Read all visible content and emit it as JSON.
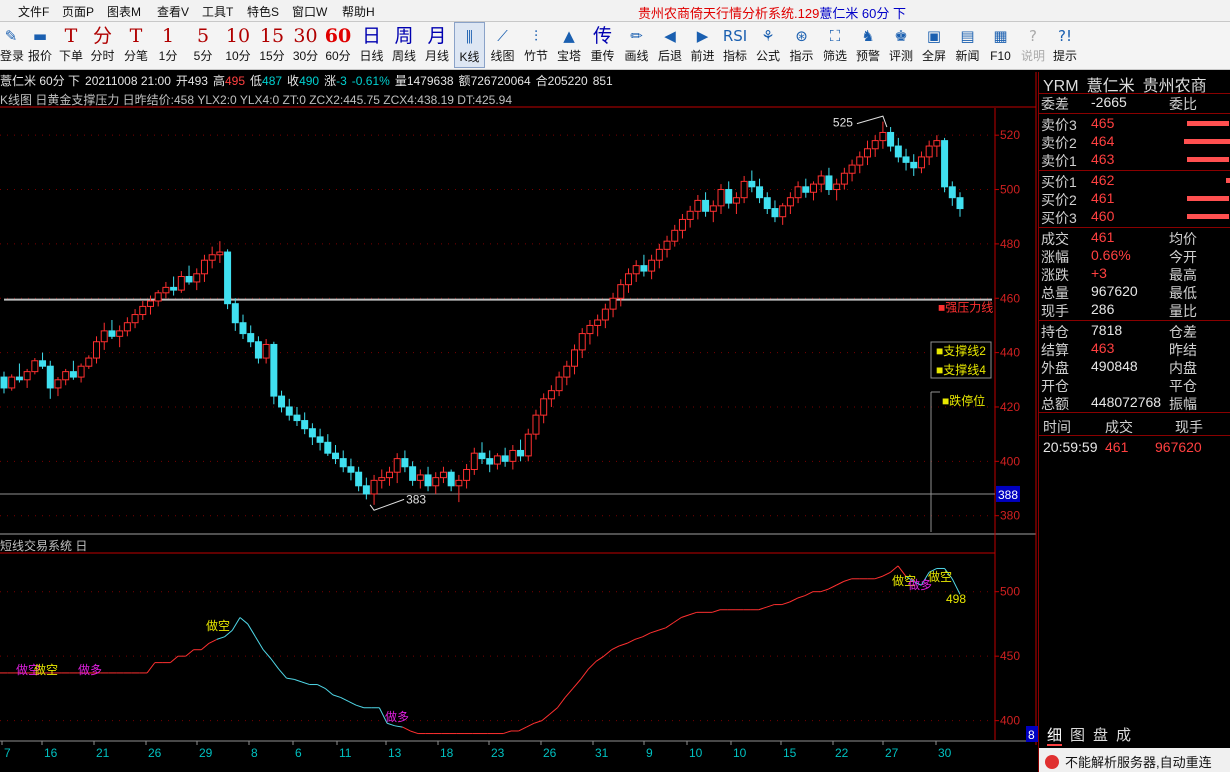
{
  "menubar": {
    "items": [
      "文件F",
      "页面P",
      "图表M",
      "查看V",
      "工具T",
      "特色S",
      "窗口W",
      "帮助H"
    ],
    "title_prefix": "贵州农商倚天行情分析系统.129",
    "title_stock": "薏仁米 60分 下"
  },
  "toolbar": [
    {
      "glyph": "✎",
      "label": "登录",
      "style": "icon"
    },
    {
      "glyph": "▬",
      "label": "报价",
      "style": "icon"
    },
    {
      "glyph": "T",
      "label": "下单",
      "style": ""
    },
    {
      "glyph": "分",
      "label": "分时",
      "style": ""
    },
    {
      "glyph": "T",
      "label": "分笔",
      "style": ""
    },
    {
      "glyph": "1",
      "label": "1分",
      "style": ""
    },
    {
      "glyph": "5",
      "label": "5分",
      "style": ""
    },
    {
      "glyph": "10",
      "label": "10分",
      "style": ""
    },
    {
      "glyph": "15",
      "label": "15分",
      "style": ""
    },
    {
      "glyph": "30",
      "label": "30分",
      "style": ""
    },
    {
      "glyph": "60",
      "label": "60分",
      "style": "red"
    },
    {
      "glyph": "日",
      "label": "日线",
      "style": "blue"
    },
    {
      "glyph": "周",
      "label": "周线",
      "style": "blue"
    },
    {
      "glyph": "月",
      "label": "月线",
      "style": "blue"
    },
    {
      "glyph": "⫼",
      "label": "K线",
      "style": "icon",
      "active": true
    },
    {
      "glyph": "⟋",
      "label": "线图",
      "style": "icon"
    },
    {
      "glyph": "⫶",
      "label": "竹节",
      "style": "icon"
    },
    {
      "glyph": "▲",
      "label": "宝塔",
      "style": "icon"
    },
    {
      "glyph": "传",
      "label": "重传",
      "style": "blue"
    },
    {
      "glyph": "✏",
      "label": "画线",
      "style": "icon"
    },
    {
      "glyph": "◀",
      "label": "后退",
      "style": "icon"
    },
    {
      "glyph": "▶",
      "label": "前进",
      "style": "icon"
    },
    {
      "glyph": "RSI",
      "label": "指标",
      "style": "icon"
    },
    {
      "glyph": "⚘",
      "label": "公式",
      "style": "icon"
    },
    {
      "glyph": "⊛",
      "label": "指示",
      "style": "icon"
    },
    {
      "glyph": "⛶",
      "label": "筛选",
      "style": "icon"
    },
    {
      "glyph": "♞",
      "label": "预警",
      "style": "icon"
    },
    {
      "glyph": "♚",
      "label": "评测",
      "style": "icon"
    },
    {
      "glyph": "▣",
      "label": "全屏",
      "style": "icon"
    },
    {
      "glyph": "▤",
      "label": "新闻",
      "style": "icon"
    },
    {
      "glyph": "▦",
      "label": "F10",
      "style": "icon"
    },
    {
      "glyph": "?",
      "label": "说明",
      "style": "icon",
      "disabled": true
    },
    {
      "glyph": "?!",
      "label": "提示",
      "style": "icon"
    }
  ],
  "quote": {
    "name_period": "薏仁米 60分 下",
    "datetime": "20211008 21:00",
    "open_label": "开",
    "open": "493",
    "high_label": "高",
    "high": "495",
    "low_label": "低",
    "low": "487",
    "close_label": "收",
    "close": "490",
    "change_label": "涨",
    "change": "-3",
    "change_pct": "-0.61%",
    "volume_label": "量",
    "volume": "1479638",
    "amount_label": "额",
    "amount": "726720064",
    "oi_label": "合",
    "oi": "205220",
    "oi_delta": "851"
  },
  "indicator_line": "K线图 日黄金支撑压力 日昨结价:458 YLX2:0 YLX4:0 ZT:0 ZCX2:445.75 ZCX4:438.19 DT:425.94",
  "chart_overlay": {
    "peak_label": "525",
    "trough_label": "383",
    "last_price_badge": "388",
    "resist_label": "■强压力线",
    "support2_label": "■支撑线2",
    "support4_label": "■支撑线4",
    "limit_down_label": "■跌停位",
    "sub_value_label": "498",
    "sub_signal_short": "做空",
    "sub_signal_long": "做多",
    "corner_label": "8"
  },
  "sub_title": "短线交易系统 日",
  "x_axis": {
    "labels": [
      "7",
      "16",
      "21",
      "26",
      "29",
      "8",
      "6",
      "11",
      "13",
      "18",
      "23",
      "26",
      "31",
      "9",
      "10",
      "10",
      "15",
      "22",
      "27",
      "30"
    ]
  },
  "right_panel": {
    "header": [
      "YRM",
      "薏仁米",
      "贵州农商"
    ],
    "weibi": {
      "k1": "委差",
      "v1": "-2665",
      "k2": "委比"
    },
    "asks": [
      {
        "k": "卖价3",
        "v": "465",
        "bar": 0.6
      },
      {
        "k": "卖价2",
        "v": "464",
        "bar": 0.65
      },
      {
        "k": "卖价1",
        "v": "463",
        "bar": 0.6
      }
    ],
    "bids": [
      {
        "k": "买价1",
        "v": "462",
        "bar": 0.05
      },
      {
        "k": "买价2",
        "v": "461",
        "bar": 0.6
      },
      {
        "k": "买价3",
        "v": "460",
        "bar": 0.6
      }
    ],
    "stats": [
      {
        "k": "成交",
        "v": "461",
        "vc": "r",
        "k2": "均价"
      },
      {
        "k": "涨幅",
        "v": "0.66%",
        "vc": "r",
        "k2": "今开"
      },
      {
        "k": "涨跌",
        "v": "+3",
        "vc": "r",
        "k2": "最高"
      },
      {
        "k": "总量",
        "v": "967620",
        "vc": "w",
        "k2": "最低"
      },
      {
        "k": "现手",
        "v": "286",
        "vc": "w",
        "k2": "量比"
      }
    ],
    "stats2": [
      {
        "k": "持仓",
        "v": "7818",
        "vc": "w",
        "k2": "仓差"
      },
      {
        "k": "结算",
        "v": "463",
        "vc": "r",
        "k2": "昨结"
      },
      {
        "k": "外盘",
        "v": "490848",
        "vc": "w",
        "k2": "内盘"
      },
      {
        "k": "开仓",
        "v": "",
        "vc": "w",
        "k2": "平仓"
      },
      {
        "k": "总额",
        "v": "448072768",
        "vc": "w",
        "k2": "振幅"
      }
    ],
    "tick_head": [
      "时间",
      "成交",
      "现手"
    ],
    "tick_row": [
      "20:59:59",
      "461",
      "967620"
    ],
    "tabs": [
      "细",
      "图",
      "盘",
      "成"
    ],
    "status": "不能解析服务器,自动重连"
  },
  "colors": {
    "up": "#ff3030",
    "down": "#40e0f0",
    "axis": "#c00000",
    "resist": "#c0c0c0"
  },
  "chart_data": {
    "type": "candlestick",
    "title": "薏仁米 60分",
    "y_axis_labels": [
      380,
      400,
      420,
      440,
      460,
      480,
      500,
      520
    ],
    "ylim": [
      374,
      530
    ],
    "resist_level": 459.5,
    "last_price_line": 388,
    "candles": [
      [
        431,
        433,
        425,
        427
      ],
      [
        427,
        432,
        426,
        431
      ],
      [
        431,
        436,
        429,
        430
      ],
      [
        430,
        434,
        427,
        433
      ],
      [
        433,
        438,
        432,
        437
      ],
      [
        437,
        440,
        434,
        435
      ],
      [
        435,
        437,
        423,
        427
      ],
      [
        427,
        431,
        424,
        430
      ],
      [
        430,
        434,
        428,
        433
      ],
      [
        433,
        437,
        430,
        431
      ],
      [
        431,
        436,
        429,
        435
      ],
      [
        435,
        439,
        434,
        438
      ],
      [
        438,
        446,
        436,
        444
      ],
      [
        444,
        451,
        441,
        448
      ],
      [
        448,
        452,
        445,
        446
      ],
      [
        446,
        450,
        442,
        448
      ],
      [
        448,
        453,
        446,
        451
      ],
      [
        451,
        456,
        449,
        454
      ],
      [
        454,
        459,
        452,
        457
      ],
      [
        457,
        461,
        454,
        459
      ],
      [
        459,
        463,
        457,
        462
      ],
      [
        462,
        466,
        460,
        464
      ],
      [
        464,
        468,
        461,
        463
      ],
      [
        463,
        470,
        462,
        468
      ],
      [
        468,
        472,
        465,
        466
      ],
      [
        466,
        471,
        463,
        469
      ],
      [
        469,
        476,
        466,
        474
      ],
      [
        474,
        479,
        471,
        476
      ],
      [
        476,
        481,
        473,
        477
      ],
      [
        477,
        478,
        456,
        458
      ],
      [
        458,
        460,
        448,
        451
      ],
      [
        451,
        454,
        445,
        447
      ],
      [
        447,
        450,
        442,
        444
      ],
      [
        444,
        446,
        436,
        438
      ],
      [
        438,
        445,
        436,
        443
      ],
      [
        443,
        444,
        421,
        424
      ],
      [
        424,
        426,
        418,
        420
      ],
      [
        420,
        423,
        415,
        417
      ],
      [
        417,
        420,
        413,
        415
      ],
      [
        415,
        418,
        410,
        412
      ],
      [
        412,
        414,
        406,
        409
      ],
      [
        409,
        412,
        404,
        407
      ],
      [
        407,
        410,
        402,
        403
      ],
      [
        403,
        406,
        399,
        401
      ],
      [
        401,
        404,
        396,
        398
      ],
      [
        398,
        401,
        393,
        396
      ],
      [
        396,
        398,
        389,
        391
      ],
      [
        391,
        394,
        386,
        388
      ],
      [
        388,
        395,
        384,
        393
      ],
      [
        393,
        397,
        390,
        394
      ],
      [
        394,
        398,
        391,
        396
      ],
      [
        396,
        403,
        392,
        401
      ],
      [
        401,
        404,
        396,
        398
      ],
      [
        398,
        400,
        391,
        393
      ],
      [
        393,
        397,
        390,
        395
      ],
      [
        395,
        398,
        389,
        391
      ],
      [
        391,
        396,
        388,
        394
      ],
      [
        394,
        398,
        392,
        396
      ],
      [
        396,
        397,
        389,
        391
      ],
      [
        391,
        395,
        385,
        393
      ],
      [
        393,
        399,
        390,
        397
      ],
      [
        397,
        405,
        395,
        403
      ],
      [
        403,
        407,
        399,
        401
      ],
      [
        401,
        404,
        396,
        399
      ],
      [
        399,
        403,
        397,
        402
      ],
      [
        402,
        405,
        398,
        400
      ],
      [
        400,
        406,
        397,
        404
      ],
      [
        404,
        408,
        400,
        402
      ],
      [
        402,
        412,
        400,
        410
      ],
      [
        410,
        419,
        408,
        417
      ],
      [
        417,
        425,
        414,
        423
      ],
      [
        423,
        428,
        420,
        426
      ],
      [
        426,
        433,
        424,
        431
      ],
      [
        431,
        437,
        428,
        435
      ],
      [
        435,
        443,
        432,
        441
      ],
      [
        441,
        449,
        438,
        447
      ],
      [
        447,
        452,
        443,
        450
      ],
      [
        450,
        454,
        446,
        452
      ],
      [
        452,
        458,
        449,
        456
      ],
      [
        456,
        462,
        453,
        460
      ],
      [
        460,
        467,
        457,
        465
      ],
      [
        465,
        471,
        462,
        469
      ],
      [
        469,
        474,
        466,
        472
      ],
      [
        472,
        476,
        468,
        470
      ],
      [
        470,
        476,
        467,
        474
      ],
      [
        474,
        480,
        471,
        478
      ],
      [
        478,
        483,
        475,
        481
      ],
      [
        481,
        487,
        479,
        485
      ],
      [
        485,
        491,
        482,
        489
      ],
      [
        489,
        494,
        486,
        492
      ],
      [
        492,
        498,
        489,
        496
      ],
      [
        496,
        499,
        490,
        492
      ],
      [
        492,
        496,
        488,
        494
      ],
      [
        494,
        502,
        491,
        500
      ],
      [
        500,
        503,
        493,
        495
      ],
      [
        495,
        499,
        491,
        497
      ],
      [
        497,
        505,
        495,
        503
      ],
      [
        503,
        507,
        499,
        501
      ],
      [
        501,
        504,
        495,
        497
      ],
      [
        497,
        499,
        491,
        493
      ],
      [
        493,
        496,
        488,
        490
      ],
      [
        490,
        495,
        487,
        494
      ],
      [
        494,
        499,
        491,
        497
      ],
      [
        497,
        503,
        495,
        501
      ],
      [
        501,
        504,
        497,
        499
      ],
      [
        499,
        503,
        496,
        502
      ],
      [
        502,
        507,
        499,
        505
      ],
      [
        505,
        508,
        498,
        500
      ],
      [
        500,
        504,
        496,
        502
      ],
      [
        502,
        508,
        500,
        506
      ],
      [
        506,
        511,
        503,
        509
      ],
      [
        509,
        514,
        506,
        512
      ],
      [
        512,
        518,
        509,
        515
      ],
      [
        515,
        520,
        512,
        518
      ],
      [
        518,
        525,
        515,
        521
      ],
      [
        521,
        523,
        514,
        516
      ],
      [
        516,
        519,
        510,
        512
      ],
      [
        512,
        515,
        507,
        510
      ],
      [
        510,
        513,
        505,
        508
      ],
      [
        508,
        514,
        506,
        512
      ],
      [
        512,
        518,
        509,
        516
      ],
      [
        516,
        520,
        512,
        518
      ],
      [
        518,
        519,
        499,
        501
      ],
      [
        501,
        503,
        494,
        497
      ],
      [
        497,
        499,
        490,
        493
      ]
    ]
  },
  "sub_chart": {
    "ylim": [
      385,
      530
    ],
    "y_axis_labels": [
      400,
      450,
      500
    ],
    "points": [
      437,
      437,
      437,
      437,
      437,
      437,
      437,
      437,
      437,
      437,
      437,
      437,
      437,
      437,
      437,
      437,
      437,
      437,
      437,
      437,
      445,
      445,
      445,
      450,
      450,
      455,
      455,
      460,
      463,
      465,
      470,
      480,
      475,
      465,
      455,
      448,
      440,
      433,
      432,
      430,
      428,
      428,
      425,
      420,
      418,
      415,
      412,
      410,
      410,
      410,
      398,
      396,
      395,
      392,
      390,
      390,
      390,
      390,
      390,
      390,
      390,
      390,
      390,
      390,
      390,
      390,
      392,
      392,
      395,
      398,
      400,
      405,
      410,
      418,
      425,
      432,
      440,
      446,
      450,
      455,
      458,
      460,
      463,
      465,
      468,
      470,
      472,
      476,
      480,
      482,
      484,
      484,
      484,
      486,
      486,
      486,
      486,
      486,
      486,
      488,
      490,
      490,
      492,
      495,
      497,
      500,
      500,
      502,
      505,
      508,
      510,
      510,
      510,
      510,
      512,
      515,
      520,
      512,
      508,
      505,
      515,
      518,
      518,
      510,
      498
    ],
    "short_color": "#50d8e8",
    "long_color": "#ff3030"
  }
}
